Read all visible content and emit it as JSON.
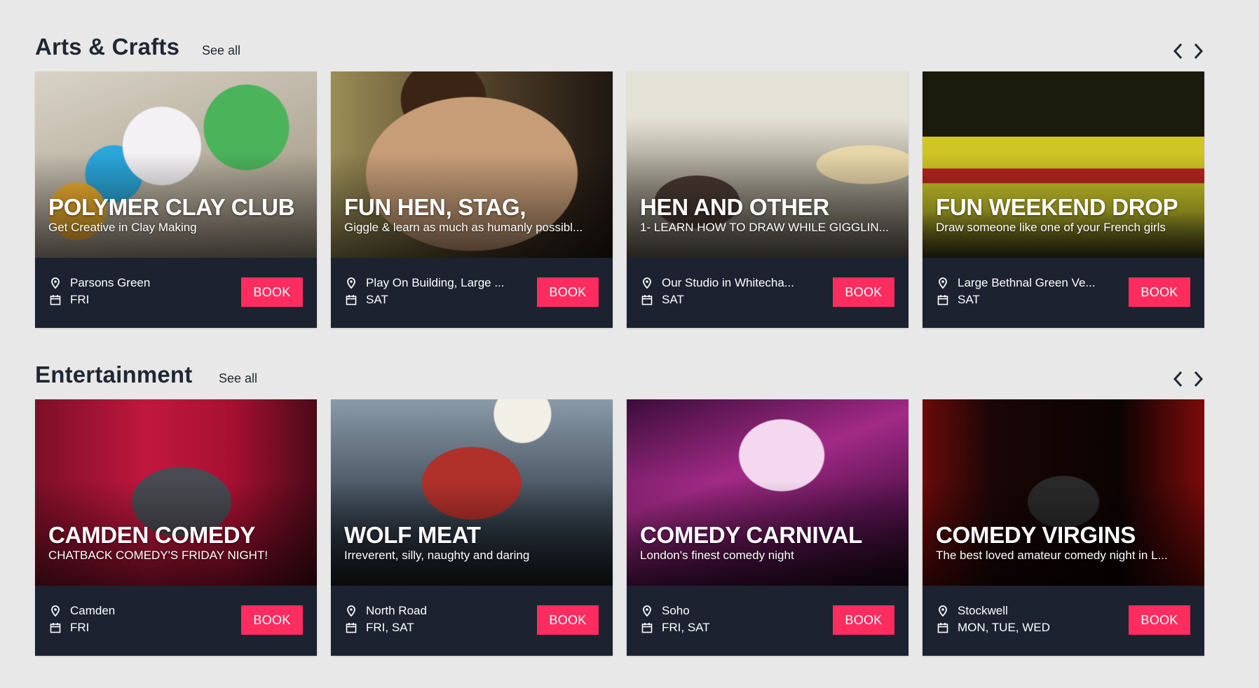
{
  "sections": [
    {
      "title": "Arts & Crafts",
      "see_all": "See all",
      "cards": [
        {
          "title": "POLYMER CLAY CLUB",
          "subtitle": "Get Creative in Clay Making",
          "location": "Parsons Green",
          "days": "FRI",
          "book": "BOOK"
        },
        {
          "title": "FUN HEN, STAG,",
          "subtitle": "Giggle & learn as much as humanly possibl...",
          "location": "Play On Building, Large ...",
          "days": "SAT",
          "book": "BOOK"
        },
        {
          "title": "HEN AND OTHER",
          "subtitle": "1- LEARN HOW TO DRAW WHILE GIGGLIN...",
          "location": "Our Studio in Whitecha...",
          "days": "SAT",
          "book": "BOOK"
        },
        {
          "title": "FUN WEEKEND DROP",
          "subtitle": "Draw someone like one of your French girls",
          "location": "Large Bethnal Green Ve...",
          "days": "SAT",
          "book": "BOOK"
        }
      ]
    },
    {
      "title": "Entertainment",
      "see_all": "See all",
      "cards": [
        {
          "title": "CAMDEN COMEDY",
          "subtitle": "CHATBACK COMEDY'S FRIDAY NIGHT!",
          "location": "Camden",
          "days": "FRI",
          "book": "BOOK"
        },
        {
          "title": "WOLF MEAT",
          "subtitle": "Irreverent, silly, naughty and daring",
          "location": "North Road",
          "days": "FRI, SAT",
          "book": "BOOK"
        },
        {
          "title": "COMEDY CARNIVAL",
          "subtitle": "London's finest comedy night",
          "location": "Soho",
          "days": "FRI, SAT",
          "book": "BOOK"
        },
        {
          "title": "COMEDY VIRGINS",
          "subtitle": "The best loved amateur comedy night in L...",
          "location": "Stockwell",
          "days": "MON, TUE, WED",
          "book": "BOOK"
        }
      ]
    }
  ],
  "colors": {
    "background": "#e8e8e8",
    "card_footer": "#1c2230",
    "book_button": "#ff2d5f",
    "heading": "#1f2733"
  },
  "icons": [
    "chevron-left-icon",
    "chevron-right-icon",
    "map-pin-icon",
    "calendar-icon"
  ]
}
